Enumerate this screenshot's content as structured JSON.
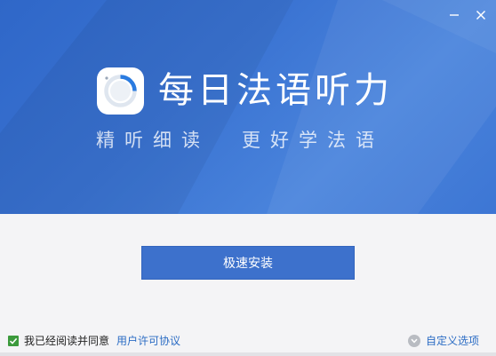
{
  "window": {
    "minimize_glyph": "—",
    "close_glyph": "✕"
  },
  "banner": {
    "app_name": "每日法语听力",
    "slogan_left": "精听细读",
    "slogan_right": "更好学法语",
    "logo_icon": "progress-ring-icon",
    "colors": {
      "gradient_start": "#2f67c8",
      "gradient_end": "#4a84dc",
      "accent_ring": "#2a7be0"
    }
  },
  "main": {
    "install_button_label": "极速安装",
    "button_color": "#3d71cc"
  },
  "footer": {
    "agree_text": "我已经阅读并同意",
    "agree_checked": true,
    "license_link": "用户许可协议",
    "custom_options_label": "自定义选项",
    "custom_options_icon": "chevron-down-icon",
    "checkbox_color": "#3c9a3c",
    "link_color": "#2b6cc4"
  }
}
